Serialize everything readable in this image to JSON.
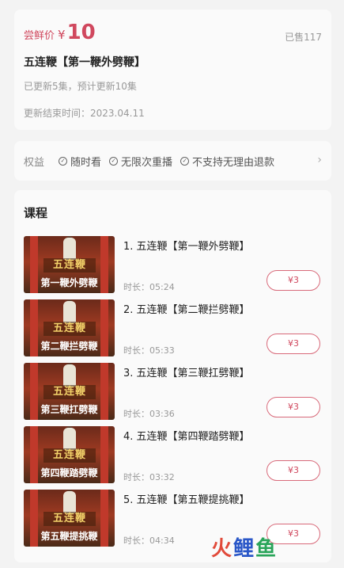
{
  "product": {
    "price_label": "尝鲜价",
    "currency": "¥",
    "price": "10",
    "sold": "已售117",
    "title": "五连鞭【第一鞭外劈鞭】",
    "update_info": "已更新5集，预计更新10集",
    "end_time": "更新结束时间：2023.04.11"
  },
  "benefits": {
    "label": "权益",
    "items": [
      "随时看",
      "无限次重播",
      "不支持无理由退款"
    ]
  },
  "course": {
    "heading": "课程",
    "duration_prefix": "时长：",
    "lessons": [
      {
        "title": "1. 五连鞭【第一鞭外劈鞭】",
        "duration": "时长：05:24",
        "price": "¥3",
        "thumb_main": "五连鞭",
        "thumb_sub": "第一鞭外劈鞭"
      },
      {
        "title": "2. 五连鞭【第二鞭拦劈鞭】",
        "duration": "时长：05:33",
        "price": "¥3",
        "thumb_main": "五连鞭",
        "thumb_sub": "第二鞭拦劈鞭"
      },
      {
        "title": "3. 五连鞭【第三鞭扛劈鞭】",
        "duration": "时长：03:36",
        "price": "¥3",
        "thumb_main": "五连鞭",
        "thumb_sub": "第三鞭扛劈鞭"
      },
      {
        "title": "4. 五连鞭【第四鞭踏劈鞭】",
        "duration": "时长：03:32",
        "price": "¥3",
        "thumb_main": "五连鞭",
        "thumb_sub": "第四鞭踏劈鞭"
      },
      {
        "title": "5. 五连鞭【第五鞭提挑鞭】",
        "duration": "时长：04:34",
        "price": "¥3",
        "thumb_main": "五连鞭",
        "thumb_sub": "第五鞭提挑鞭"
      }
    ]
  },
  "watermark": [
    "火",
    "鲤",
    "鱼"
  ],
  "colors": {
    "accent": "#d0485e",
    "muted": "#999999"
  }
}
